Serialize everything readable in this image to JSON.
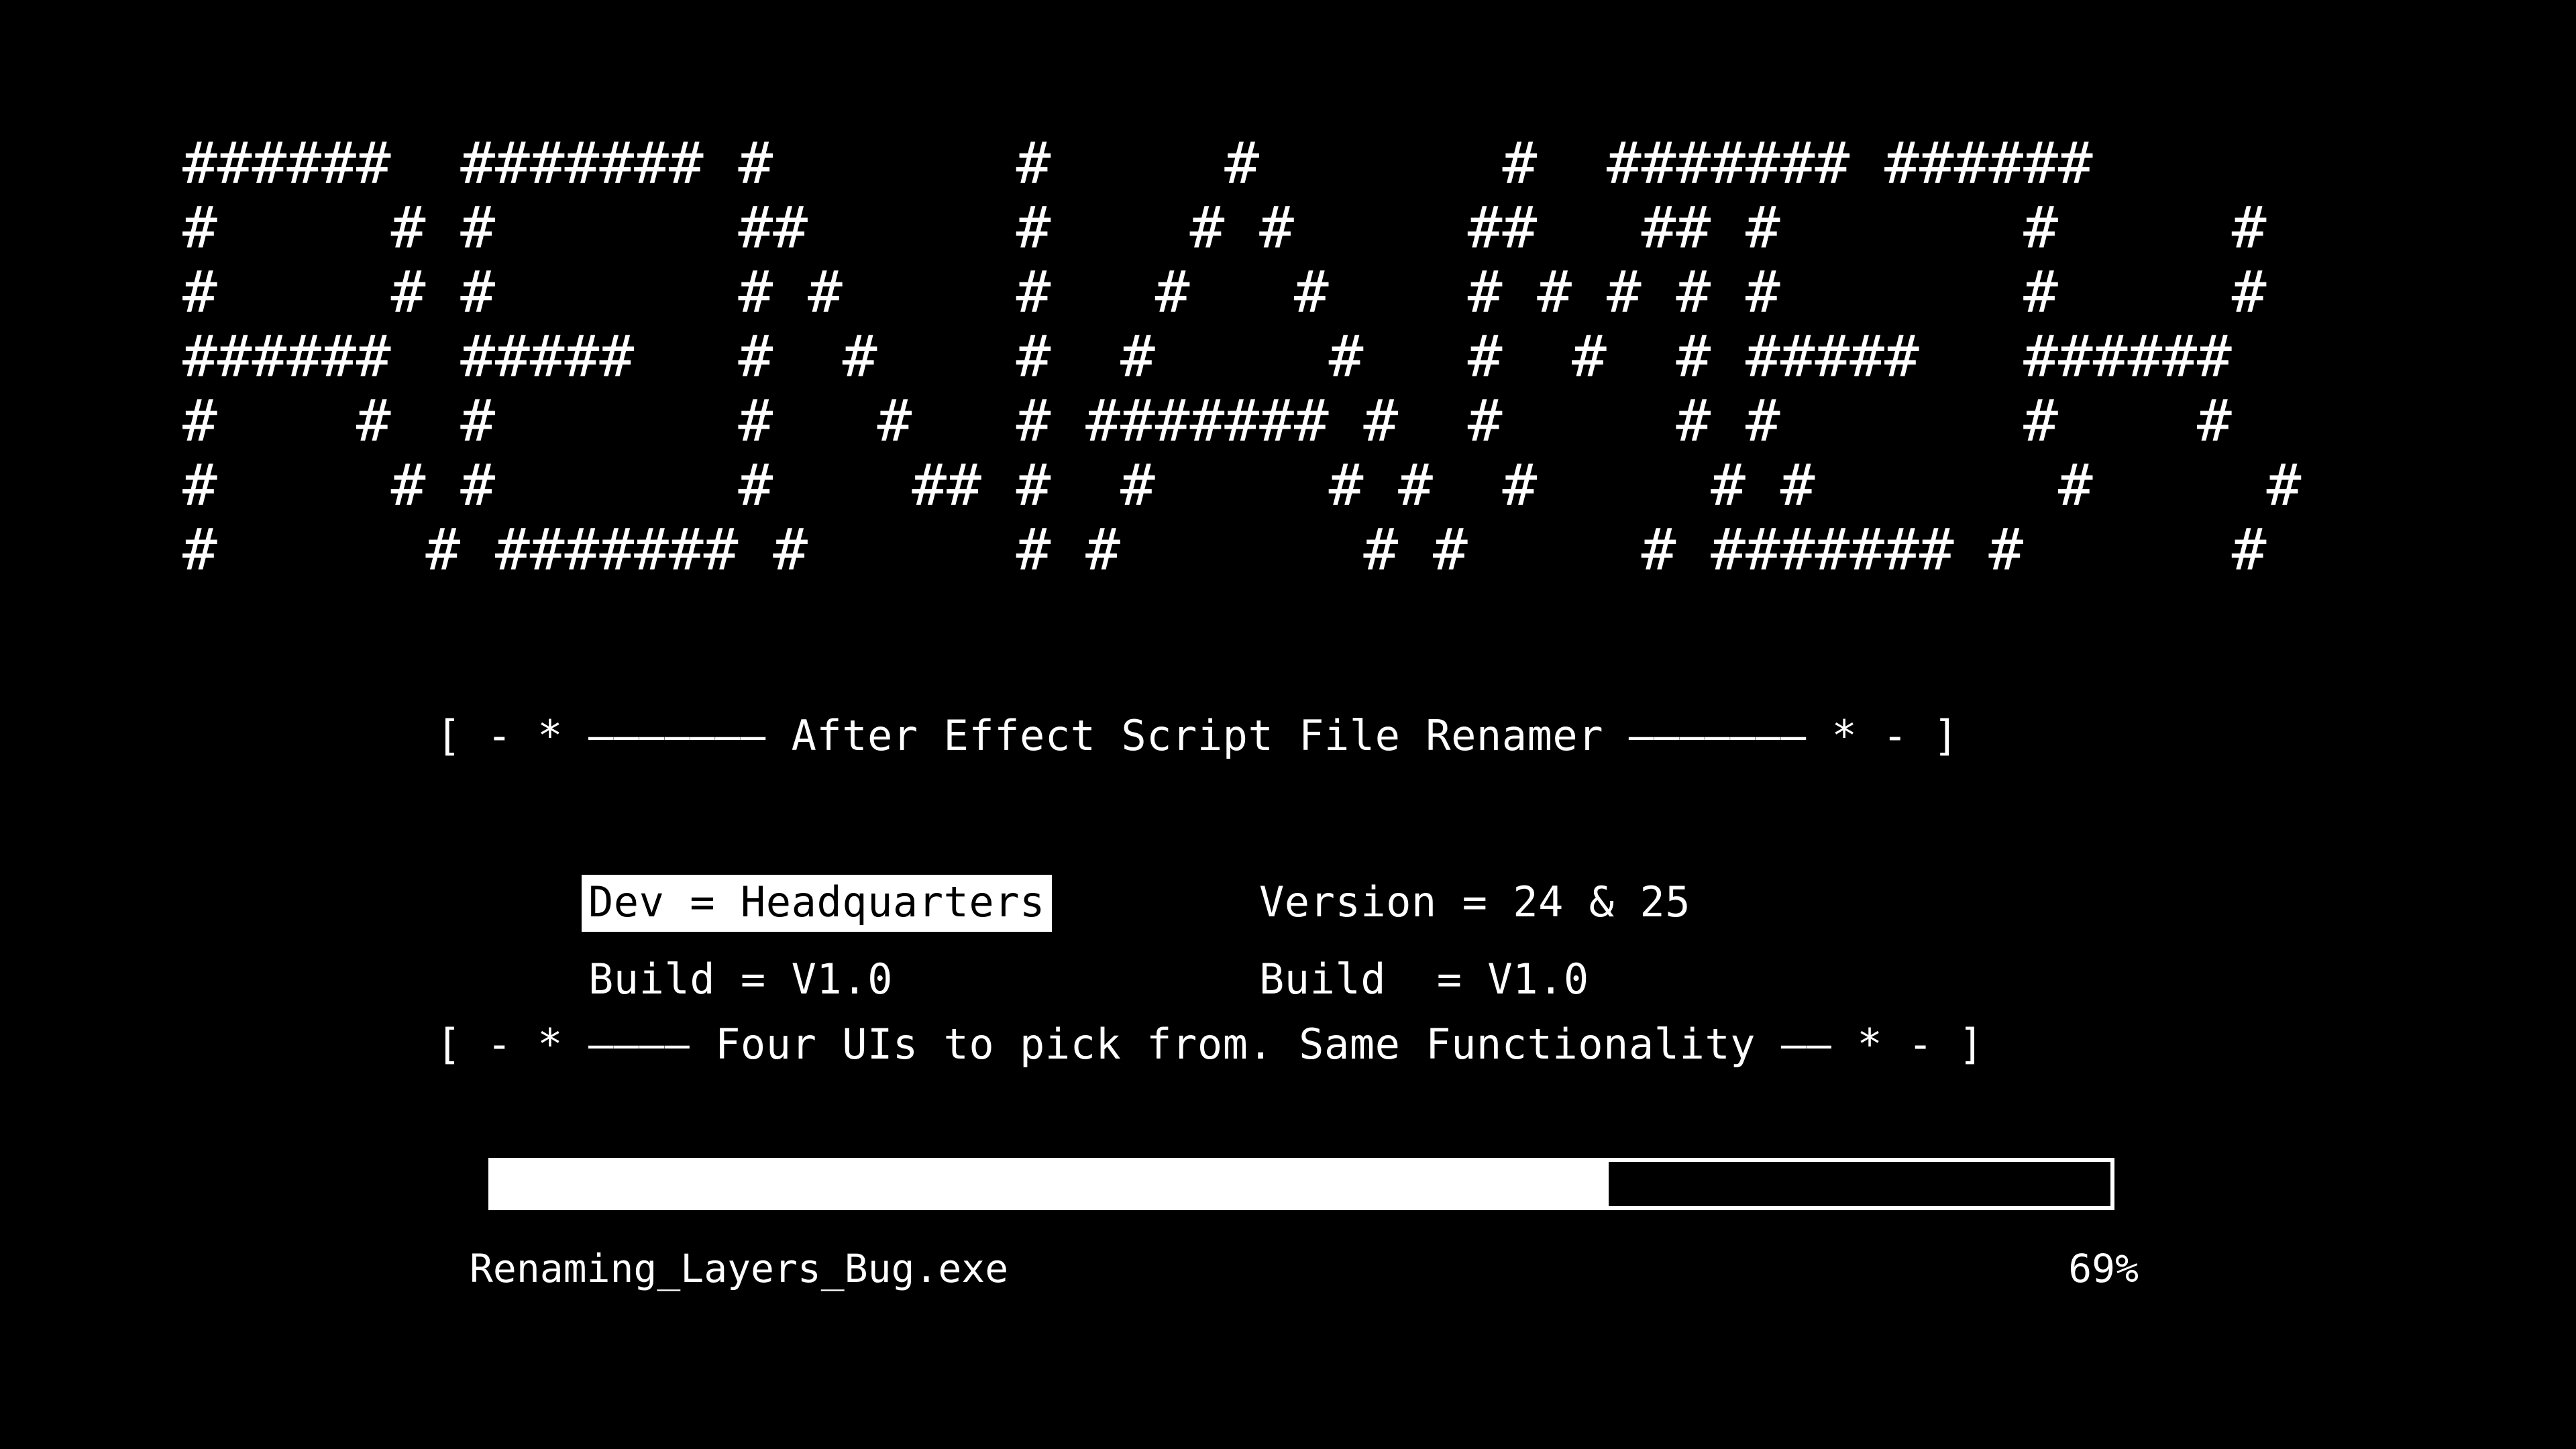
{
  "theme": {
    "background": "#000000",
    "foreground": "#ffffff",
    "highlight_bg": "#ffffff",
    "highlight_fg": "#000000"
  },
  "banner": {
    "word": "RENAMER",
    "ascii_art": "######  ####### #       #     #       #  ####### ######\n#     # #       ##      #    # #     ##   ## #       #     #\n#     # #       # #     #   #   #    # # # # #       #     #\n######  #####   #  #    #  #     #   #  #  # #####   ######\n#    #  #       #   #   # ####### #  #     # #       #    #\n#     # #       #    ## #  #     # #  #     # #       #     #\n#      # ####### #      # #       # #     # ####### #      #"
  },
  "header_rule": {
    "text": "[ - * ——————— After Effect Script File Renamer ——————— * - ]"
  },
  "info": {
    "left": {
      "dev_line": "Dev = Headquarters",
      "build_line": "Build = V1.0"
    },
    "right": {
      "version_line": "Version = 24 & 25",
      "build_line": "Build  = V1.0"
    }
  },
  "footer_rule": {
    "text": "[ - * ———— Four UIs to pick from. Same Functionality —— * - ]"
  },
  "progress": {
    "percent": 69,
    "percent_label": "69%",
    "file_label": "Renaming_Layers_Bug.exe",
    "fill_width": "69%"
  }
}
